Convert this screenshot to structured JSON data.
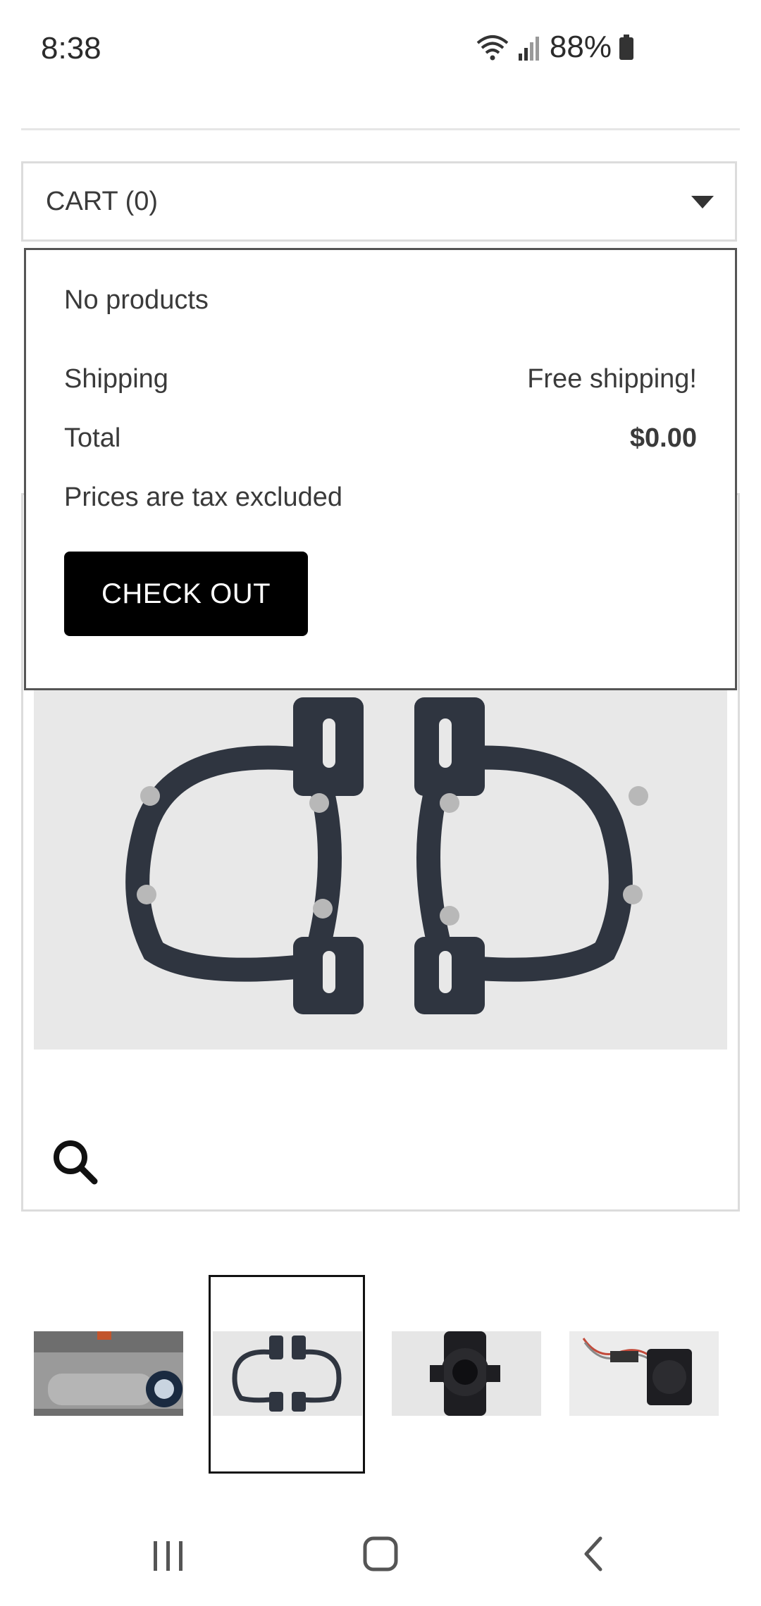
{
  "status_bar": {
    "time": "8:38",
    "battery": "88%"
  },
  "cart": {
    "label": "CART (0)",
    "dropdown": {
      "empty_text": "No products",
      "shipping_label": "Shipping",
      "shipping_value": "Free shipping!",
      "total_label": "Total",
      "total_value": "$0.00",
      "tax_note": "Prices are tax excluded",
      "checkout_label": "CHECK OUT"
    }
  },
  "icons": {
    "cart_toggle": "chevron-down-icon",
    "zoom": "search-icon",
    "nav_recent": "recent-apps-icon",
    "nav_home": "home-icon",
    "nav_back": "back-icon"
  },
  "thumbnails": {
    "count": 4,
    "selected_index": 1
  }
}
